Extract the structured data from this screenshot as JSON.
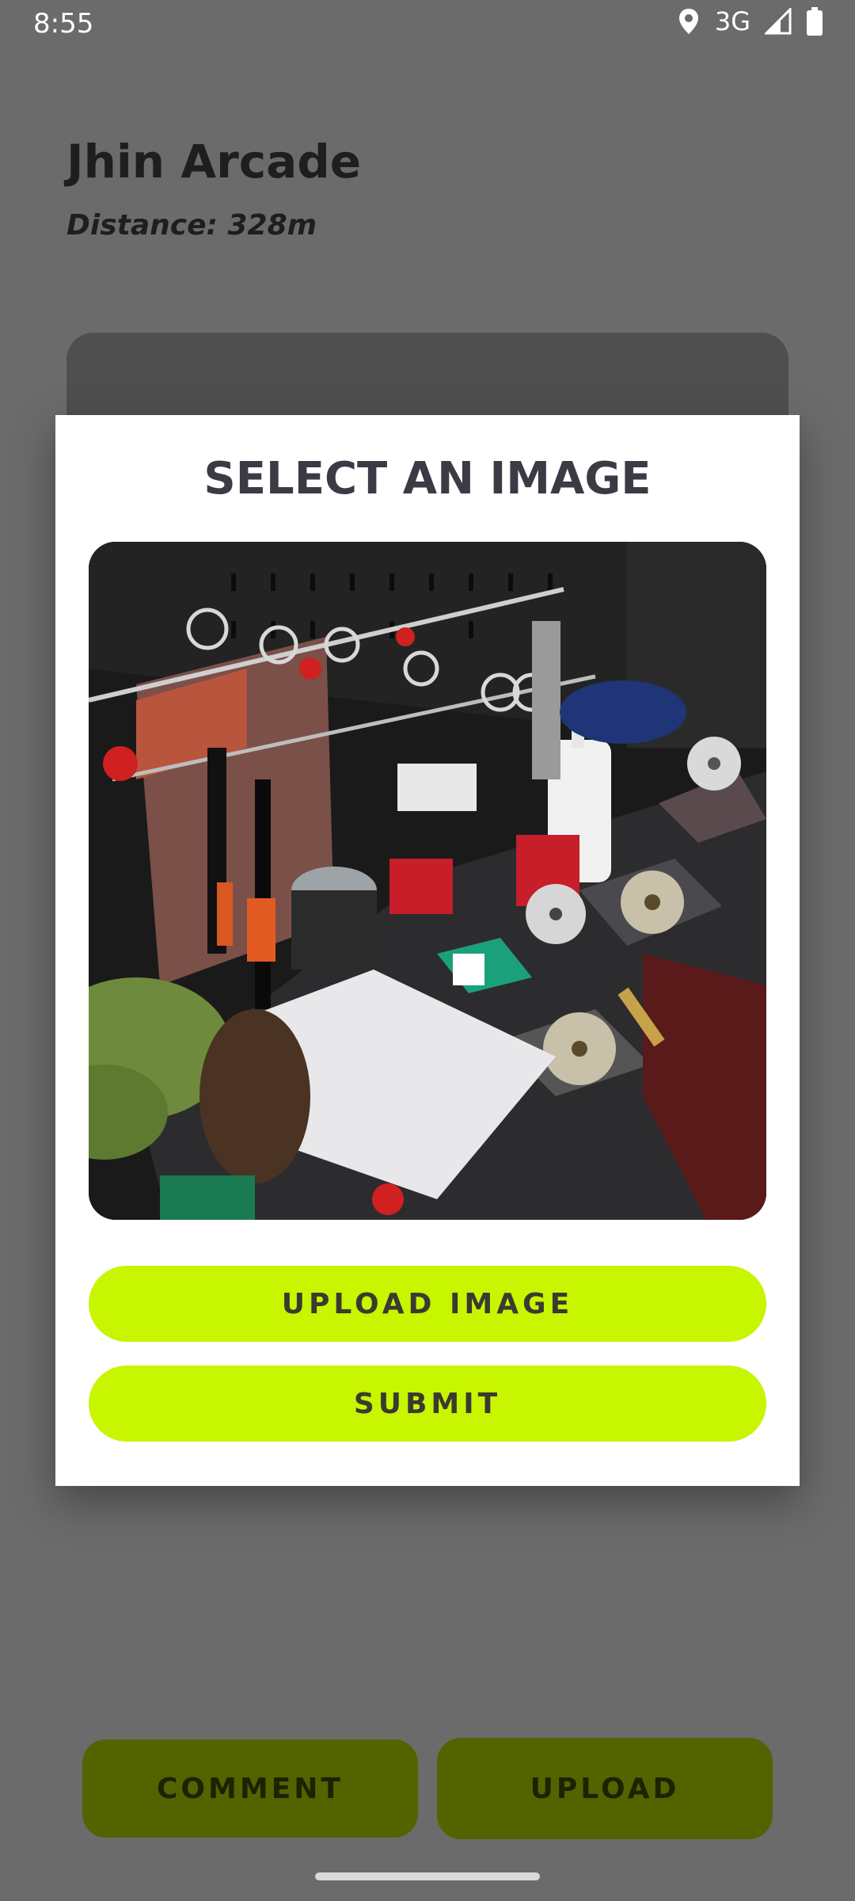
{
  "status_bar": {
    "time": "8:55",
    "network": "3G",
    "icons": [
      "location-icon",
      "signal-icon",
      "battery-icon"
    ]
  },
  "page": {
    "title": "Jhin Arcade",
    "distance": "Distance: 328m"
  },
  "bottom_actions": {
    "comment_label": "COMMENT",
    "upload_label": "UPLOAD"
  },
  "dialog": {
    "title": "SELECT AN IMAGE",
    "preview_image": "photo-of-arcade-desk-with-keychains-cds-and-jars",
    "upload_button_label": "UPLOAD IMAGE",
    "submit_button_label": "SUBMIT"
  },
  "colors": {
    "accent": "#c8f500",
    "accent_dimmed": "#536300",
    "scrim": "#6b6b6b",
    "dialog_bg": "#ffffff",
    "title_text": "#3b3b46"
  }
}
